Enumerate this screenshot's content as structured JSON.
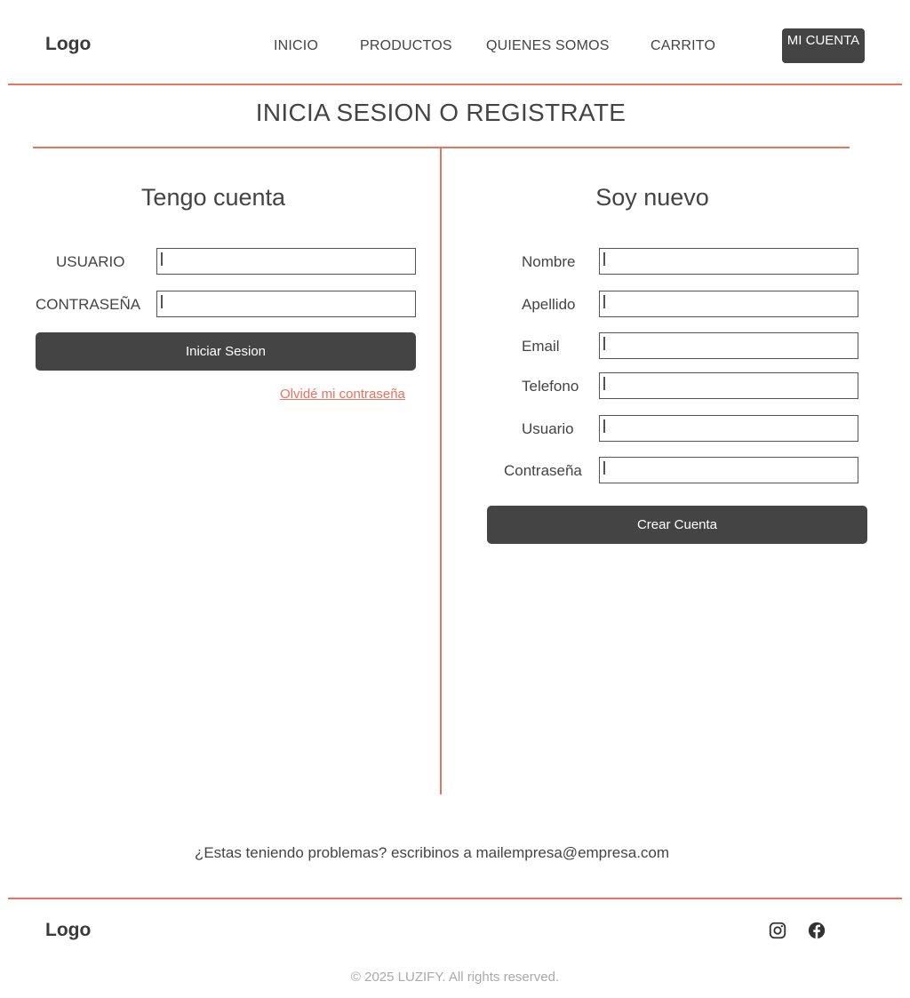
{
  "header": {
    "logo": "Logo",
    "nav": [
      "INICIO",
      "PRODUCTOS",
      "QUIENES SOMOS",
      "CARRITO"
    ],
    "account_button": "MI CUENTA"
  },
  "main": {
    "title": "INICIA SESION O REGISTRATE",
    "login": {
      "title": "Tengo cuenta",
      "fields": [
        {
          "label": "USUARIO",
          "value": ""
        },
        {
          "label": "CONTRASEÑA",
          "value": ""
        }
      ],
      "submit_label": "Iniciar Sesion",
      "forgot_label": "Olvidé mi contraseña"
    },
    "register": {
      "title": "Soy nuevo",
      "fields": [
        {
          "label": "Nombre",
          "value": ""
        },
        {
          "label": "Apellido",
          "value": ""
        },
        {
          "label": "Email",
          "value": ""
        },
        {
          "label": "Telefono",
          "value": ""
        },
        {
          "label": "Usuario",
          "value": ""
        },
        {
          "label": "Contraseña",
          "value": ""
        }
      ],
      "submit_label": "Crear Cuenta"
    },
    "help_text": "¿Estas teniendo problemas? escribinos a mailempresa@empresa.com"
  },
  "footer": {
    "logo": "Logo",
    "social": [
      {
        "icon": "instagram-icon"
      },
      {
        "icon": "facebook-icon"
      }
    ],
    "copyright": "© 2025 LUZIFY. All rights reserved."
  },
  "colors": {
    "accent": "#e8735e",
    "dark": "#444444",
    "muted": "#a9a9a9"
  }
}
